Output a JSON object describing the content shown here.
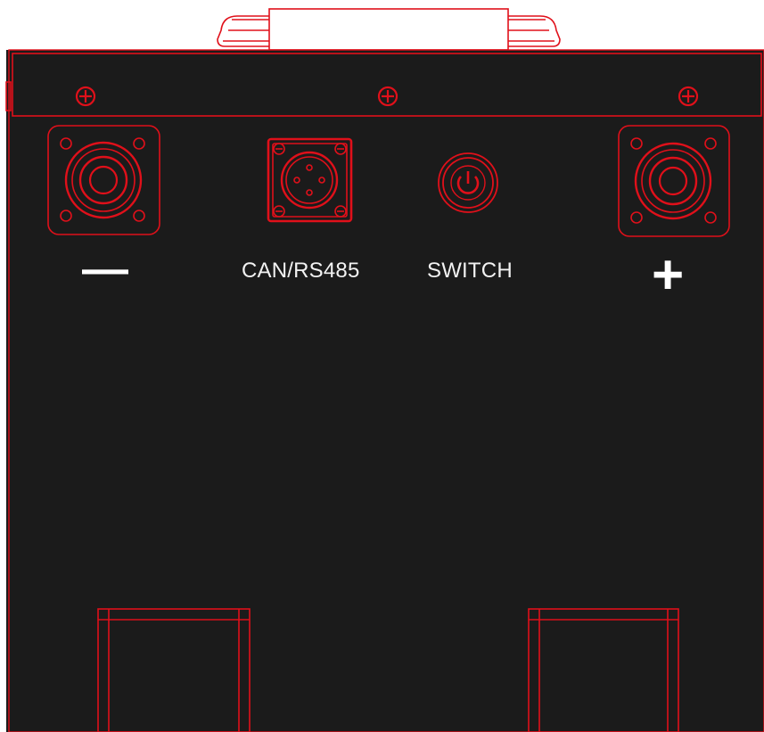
{
  "labels": {
    "negative": "—",
    "can_rs485": "CAN/RS485",
    "switch": "SWITCH",
    "positive": "+"
  },
  "colors": {
    "panel": "#1b1b1b",
    "outline": "#e0101a",
    "label_text": "#f2f2f2",
    "background": "#ffffff"
  },
  "icons": {
    "negative_terminal": "negative-terminal-icon",
    "can_connector": "can-rs485-connector-icon",
    "power_switch": "power-button-icon",
    "positive_terminal": "positive-terminal-icon",
    "screw": "screw-icon"
  }
}
